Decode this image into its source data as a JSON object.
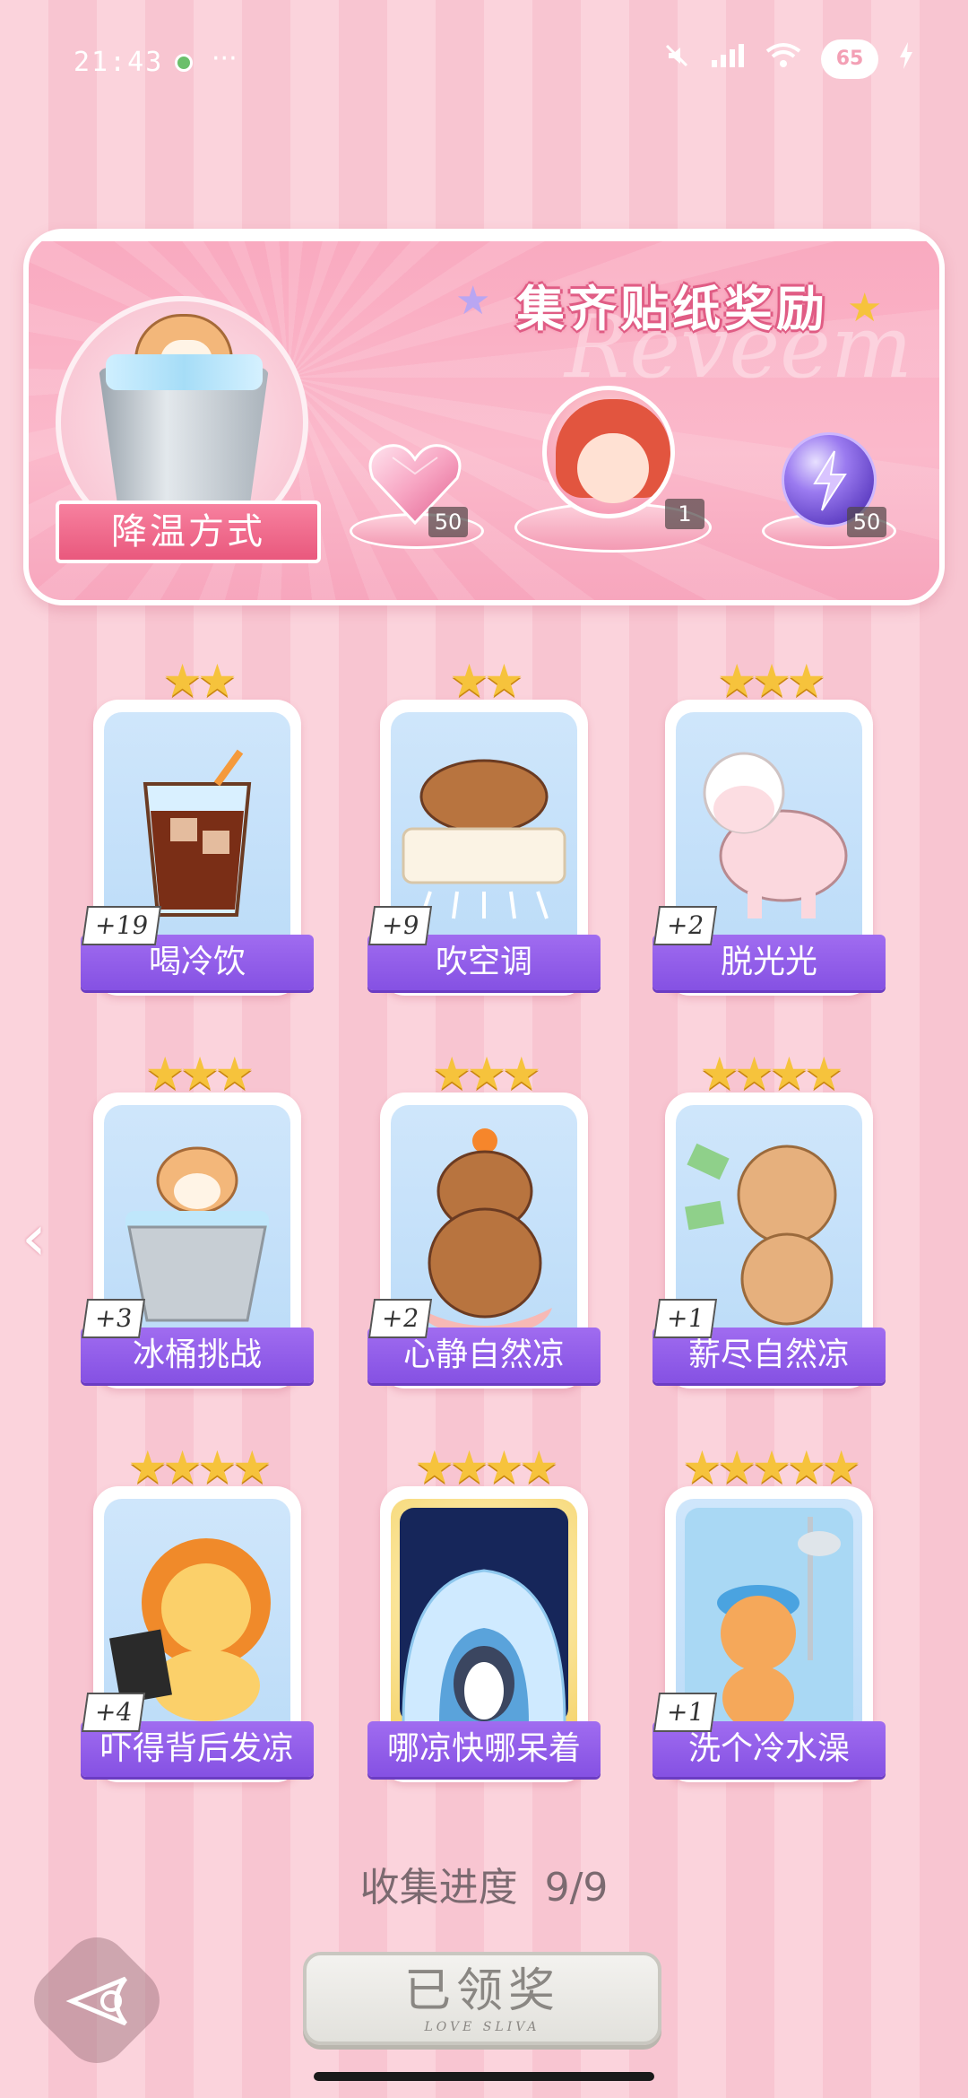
{
  "status_bar": {
    "time": "21:43",
    "more": "···",
    "battery": "65",
    "icons": [
      "green-dot-icon",
      "mute-icon",
      "signal-icon",
      "wifi-icon",
      "battery-icon",
      "charging-icon"
    ]
  },
  "banner": {
    "title": "集齐贴纸奖励",
    "watermark": "Reveem",
    "badge_label": "降温方式",
    "rewards": [
      {
        "name": "heart-gem-icon",
        "count": "50"
      },
      {
        "name": "avatar-reward",
        "count": "1"
      },
      {
        "name": "energy-orb-icon",
        "count": "50"
      }
    ]
  },
  "stickers": [
    {
      "label": "喝冷饮",
      "bonus": "+19",
      "stars": "★★",
      "icon": "iced-drink-icon"
    },
    {
      "label": "吹空调",
      "bonus": "+9",
      "stars": "★★",
      "icon": "capybara-ac-icon"
    },
    {
      "label": "脱光光",
      "bonus": "+2",
      "stars": "★★★",
      "icon": "sheared-sheep-icon"
    },
    {
      "label": "冰桶挑战",
      "bonus": "+3",
      "stars": "★★★",
      "icon": "hamster-ice-bucket-icon"
    },
    {
      "label": "心静自然凉",
      "bonus": "+2",
      "stars": "★★★",
      "icon": "meditating-capybara-icon"
    },
    {
      "label": "薪尽自然凉",
      "bonus": "+1",
      "stars": "★★★★",
      "icon": "crying-bear-money-icon"
    },
    {
      "label": "吓得背后发凉",
      "bonus": "+4",
      "stars": "★★★★",
      "icon": "scared-lion-icon"
    },
    {
      "label": "哪凉快哪呆着",
      "bonus": "",
      "stars": "★★★★",
      "icon": "penguin-igloo-icon"
    },
    {
      "label": "洗个冷水澡",
      "bonus": "+1",
      "stars": "★★★★★",
      "icon": "cat-shower-icon"
    }
  ],
  "progress": {
    "label": "收集进度",
    "value": "9/9"
  },
  "claim_button": {
    "label": "已领奖",
    "sub": "LOVE SLIVA"
  },
  "colors": {
    "accent": "#8551e3",
    "pink": "#f7819f",
    "star": "#f6c33c"
  }
}
